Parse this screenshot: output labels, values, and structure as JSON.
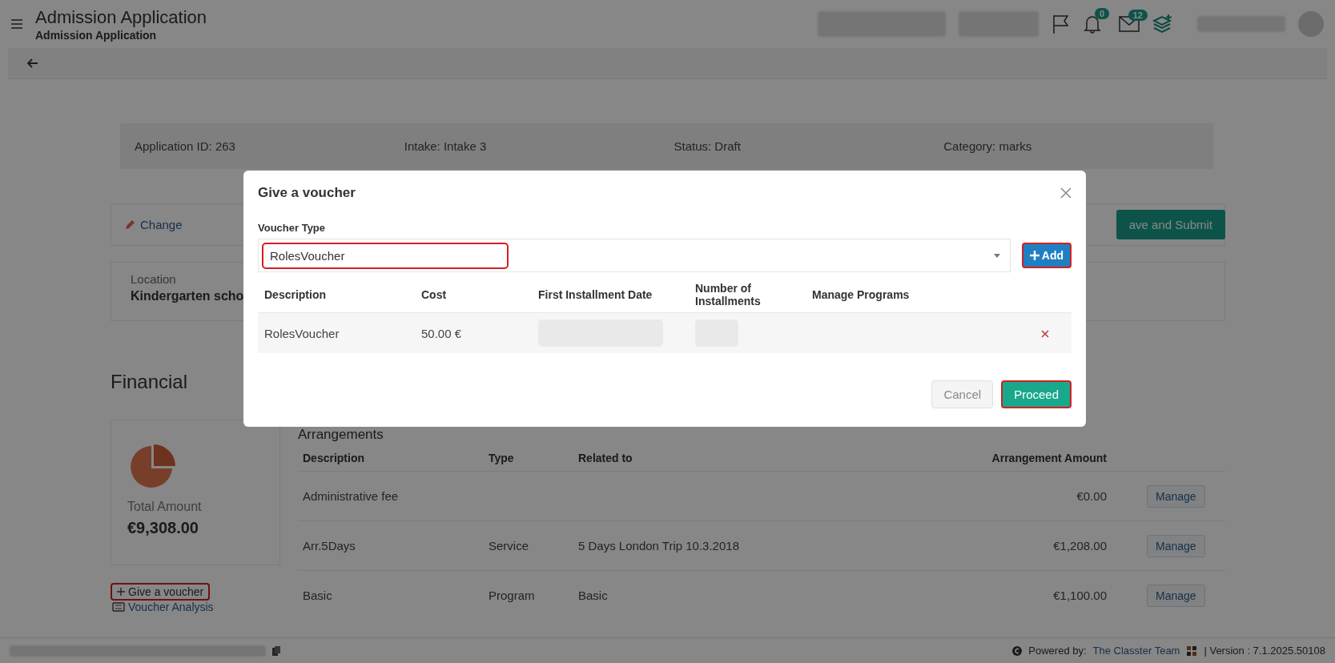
{
  "header": {
    "title": "Admission Application",
    "subtitle": "Admission Application",
    "notifications": "0",
    "messages": "12"
  },
  "summary": [
    "Application ID: 263",
    "Intake: Intake 3",
    "Status: Draft",
    "Category: marks"
  ],
  "actions": {
    "change": "Change",
    "submit": "ave and Submit"
  },
  "location": {
    "label": "Location",
    "value": "Kindergarten scho"
  },
  "financial": {
    "title": "Financial",
    "total_label": "Total Amount",
    "total": "€9,308.00",
    "give_voucher": {
      "label": "Give a voucher",
      "highlighted": true
    },
    "voucher_analysis": "Voucher Analysis"
  },
  "arrangements": {
    "title": "Arrangements",
    "columns": [
      "Description",
      "Type",
      "Related to",
      "Arrangement Amount"
    ],
    "rows": [
      {
        "description": "Administrative fee",
        "amount": "€0.00",
        "action": "Manage"
      },
      {
        "description": "Arr.5Days",
        "type": "Service",
        "related": "5 Days London Trip 10.3.2018",
        "amount": "€1,208.00",
        "action": "Manage"
      },
      {
        "description": "Basic",
        "type": "Program",
        "related": "Basic",
        "amount": "€1,100.00",
        "action": "Manage"
      }
    ]
  },
  "modal": {
    "title": "Give a voucher",
    "field_label": "Voucher Type",
    "value": "RolesVoucher",
    "value_highlighted": true,
    "add": {
      "label": "Add",
      "highlighted": true
    },
    "columns": [
      "Description",
      "Cost",
      "First Installment Date",
      "Number of Installments",
      "Manage Programs"
    ],
    "rows": [
      {
        "description": "RolesVoucher",
        "cost": "50.00 €"
      }
    ],
    "cancel": "Cancel",
    "proceed": {
      "label": "Proceed",
      "highlighted": true
    }
  },
  "footer": {
    "powered_by": "Powered by:",
    "team": "The Classter Team",
    "version": "| Version : 7.1.2025.50108"
  }
}
